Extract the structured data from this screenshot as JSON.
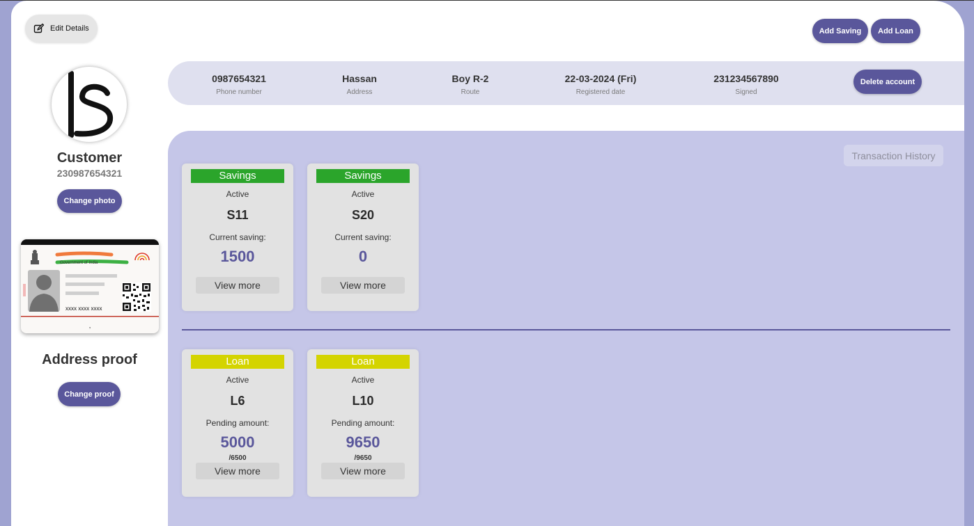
{
  "header": {
    "edit_label": "Edit Details",
    "add_saving_label": "Add Saving",
    "add_loan_label": "Add Loan"
  },
  "profile": {
    "name": "Customer",
    "id": "230987654321",
    "change_photo_label": "Change photo",
    "proof_title": "Address proof",
    "change_proof_label": "Change proof",
    "id_card": {
      "gov_text": "Government of India",
      "number_text": "xxxx xxxx xxxx",
      "footer_text": ","
    }
  },
  "info": {
    "phone": {
      "value": "0987654321",
      "label": "Phone number"
    },
    "address": {
      "value": "Hassan",
      "label": "Address"
    },
    "route": {
      "value": "Boy R-2",
      "label": "Route"
    },
    "registered": {
      "value": "22-03-2024 (Fri)",
      "label": "Registered date"
    },
    "signed": {
      "value": "231234567890",
      "label": "Signed"
    },
    "delete_label": "Delete account"
  },
  "transaction_history_label": "Transaction History",
  "savings": [
    {
      "type": "Savings",
      "status": "Active",
      "id": "S11",
      "amount_label": "Current saving:",
      "amount": "1500",
      "more_label": "View more"
    },
    {
      "type": "Savings",
      "status": "Active",
      "id": "S20",
      "amount_label": "Current saving:",
      "amount": "0",
      "more_label": "View more"
    }
  ],
  "loans": [
    {
      "type": "Loan",
      "status": "Active",
      "id": "L6",
      "amount_label": "Pending amount:",
      "amount": "5000",
      "total": "/6500",
      "more_label": "View more"
    },
    {
      "type": "Loan",
      "status": "Active",
      "id": "L10",
      "amount_label": "Pending amount:",
      "amount": "9650",
      "total": "/9650",
      "more_label": "View more"
    }
  ],
  "colors": {
    "accent": "#5a579b",
    "savings_header": "#2ba52b",
    "loan_header": "#d4d400",
    "background": "#9fa3d1",
    "main_area": "#c5c6e8",
    "info_bar": "#dfe0ef"
  },
  "icons": {
    "edit": "edit-icon",
    "logo": "brand-logo",
    "emblem": "emblem-icon",
    "fingerprint": "fingerprint-icon",
    "qr": "qr-code-icon",
    "person": "person-silhouette-icon"
  }
}
